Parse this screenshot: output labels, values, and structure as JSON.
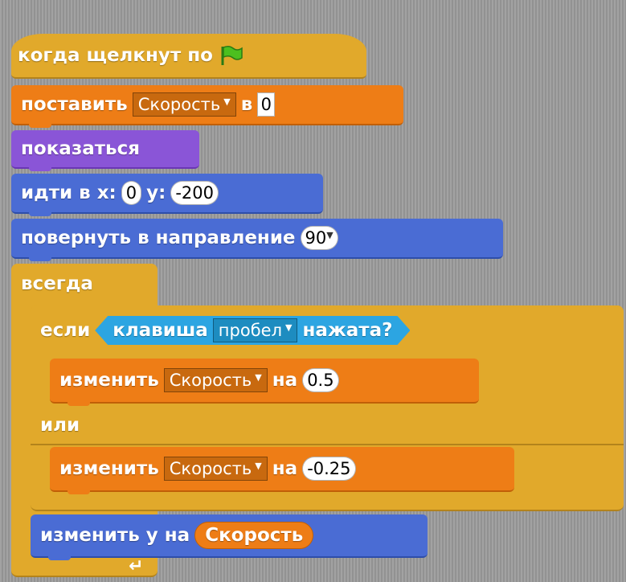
{
  "script": {
    "hat": {
      "label": "когда щелкнут по",
      "icon": "green-flag-icon"
    },
    "set_var": {
      "label": "поставить",
      "variable": "Скорость",
      "to_label": "в",
      "value": "0"
    },
    "show": {
      "label": "показаться"
    },
    "goto": {
      "label": "идти в x:",
      "x": "0",
      "y_label": "y:",
      "y": "-200"
    },
    "point": {
      "label": "повернуть в направление",
      "value": "90"
    },
    "forever": {
      "label": "всегда"
    },
    "if_else": {
      "if_label": "если",
      "condition": {
        "label": "клавиша",
        "key": "пробел",
        "suffix": "нажата?"
      },
      "else_label": "или"
    },
    "change_var_1": {
      "label": "изменить",
      "variable": "Скорость",
      "by_label": "на",
      "value": "0.5"
    },
    "change_var_2": {
      "label": "изменить",
      "variable": "Скорость",
      "by_label": "на",
      "value": "-0.25"
    },
    "change_y": {
      "label": "изменить у на",
      "reporter": "Скорость"
    }
  },
  "colors": {
    "events": "#e1a92b",
    "data": "#ee7d16",
    "looks": "#8a55d7",
    "motion": "#4a6cd4",
    "control": "#e1a92b",
    "sensing": "#2ca5e2"
  }
}
